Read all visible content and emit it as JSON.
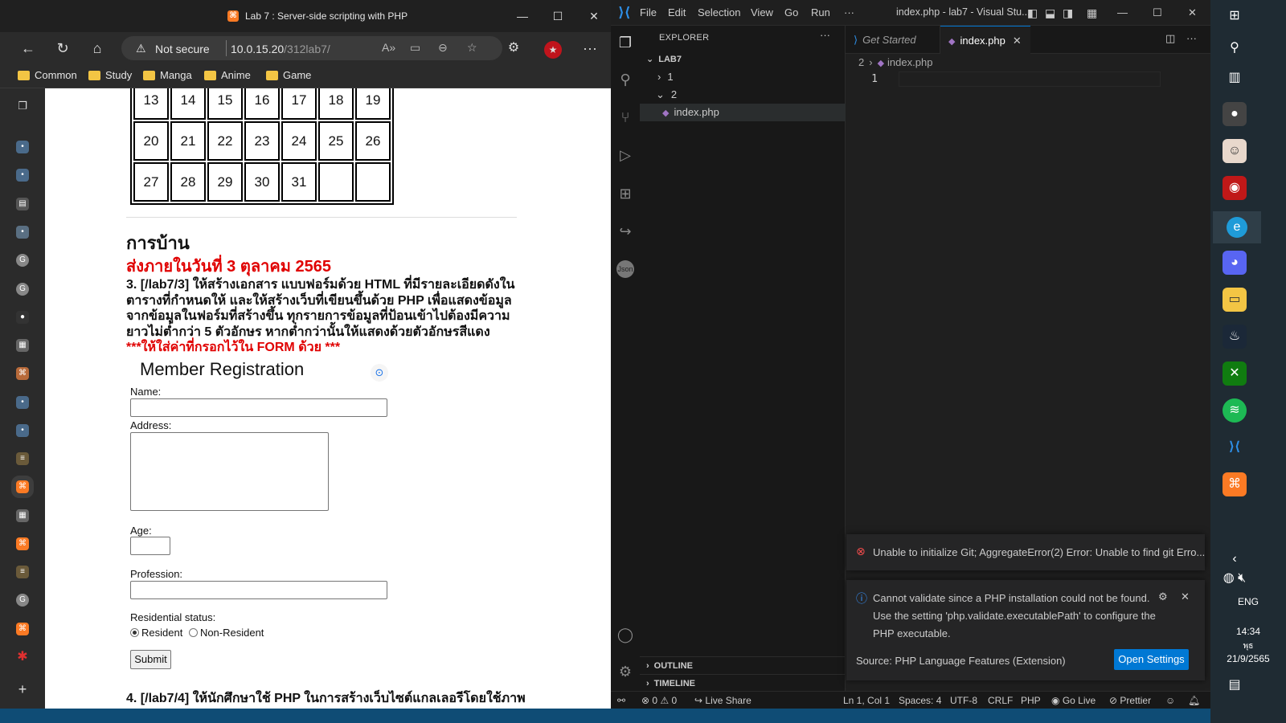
{
  "browser": {
    "tab_title": "Lab 7 : Server-side scripting with PHP",
    "security_label": "Not secure",
    "url_host": "10.0.15.20",
    "url_path": "/312lab7/",
    "bookmarks": [
      "Common",
      "Study",
      "Manga",
      "Anime",
      "Game"
    ]
  },
  "page": {
    "calendar_rows": [
      [
        "13",
        "14",
        "15",
        "16",
        "17",
        "18",
        "19"
      ],
      [
        "20",
        "21",
        "22",
        "23",
        "24",
        "25",
        "26"
      ],
      [
        "27",
        "28",
        "29",
        "30",
        "31",
        "",
        ""
      ]
    ],
    "homework_title": "การบ้าน",
    "due_date": "ส่งภายในวันที่ 3 ตุลาคม 2565",
    "q3_text": "3. [/lab7/3] ให้สร้างเอกสาร แบบฟอร์มด้วย HTML ที่มีรายละเอียดดังในตารางที่กำหนดให้ และให้สร้างเว็บที่เขียนขึ้นด้วย PHP เพื่อแสดงข้อมูลจากข้อมูลในฟอร์มที่สร้างขึ้น ทุกรายการข้อมูลที่ป้อนเข้าไปต้องมีความยาวไม่ต่ำกว่า 5 ตัวอักษร หากต่ำกว่านั้นให้แสดงด้วยตัวอักษรสีแดง",
    "q3_note": "***ให้ใส่ค่าที่กรอกไว้ใน FORM ด้วย ***",
    "form_title": "Member Registration",
    "name_label": "Name:",
    "address_label": "Address:",
    "age_label": "Age:",
    "profession_label": "Profession:",
    "residential_label": "Residential status:",
    "resident_option": "Resident",
    "nonresident_option": "Non-Resident",
    "submit_label": "Submit",
    "q4_text": "4. [/lab7/4] ให้นักศึกษาใช้ PHP ในการสร้างเว็บไซต์แกลเลอรีโดยใช้ภาพ"
  },
  "vscode": {
    "menu": [
      "File",
      "Edit",
      "Selection",
      "View",
      "Go",
      "Run",
      "···"
    ],
    "window_title": "index.php - lab7 - Visual Stu...",
    "explorer_label": "EXPLORER",
    "workspace": "LAB7",
    "folder_1": "1",
    "folder_2": "2",
    "file": "index.php",
    "outline": "OUTLINE",
    "timeline": "TIMELINE",
    "tab_get_started": "Get Started",
    "tab_index": "index.php",
    "crumb_folder": "2",
    "crumb_file": "index.php",
    "line_number": "1",
    "git_error": "Unable to initialize Git; AggregateError(2) Error: Unable to find git Erro...",
    "php_msg_1": "Cannot validate since a PHP installation could not be found.",
    "php_msg_2": "Use the setting 'php.validate.executablePath' to configure the",
    "php_msg_3": "PHP executable.",
    "php_source": "Source: PHP Language Features (Extension)",
    "open_settings": "Open Settings",
    "status": {
      "errors": "0",
      "warnings": "0",
      "live_share": "Live Share",
      "position": "Ln 1, Col 1",
      "spaces": "Spaces: 4",
      "encoding": "UTF-8",
      "eol": "CRLF",
      "language": "PHP",
      "go_live": "Go Live",
      "prettier": "Prettier"
    }
  },
  "taskbar": {
    "lang": "ENG",
    "time": "14:34",
    "day": "พุธ",
    "date": "21/9/2565"
  },
  "colors": {
    "vscode_accent": "#0078d4",
    "homework_red": "#e00000"
  }
}
